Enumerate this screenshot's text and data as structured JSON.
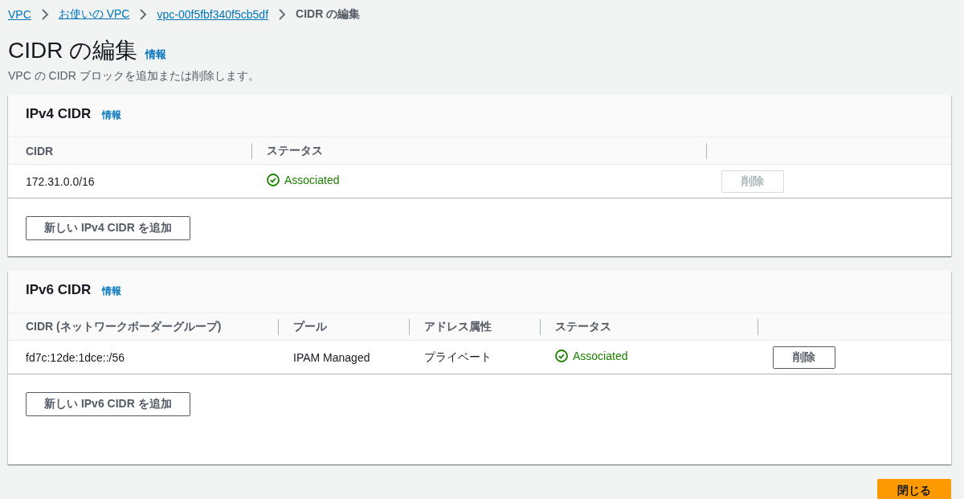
{
  "breadcrumbs": [
    {
      "label": "VPC",
      "kind": "link"
    },
    {
      "label": "お使いの VPC",
      "kind": "link"
    },
    {
      "label": "vpc-00f5fbf340f5cb5df",
      "kind": "link"
    },
    {
      "label": "CIDR の編集",
      "kind": "current"
    }
  ],
  "page": {
    "title": "CIDR の編集",
    "info": "情報",
    "description": "VPC の CIDR ブロックを追加または削除します。"
  },
  "sections": [
    {
      "title": "IPv4 CIDR",
      "info": "情報",
      "columns": [
        "CIDR",
        "ステータス",
        ""
      ],
      "rows": [
        {
          "cells": [
            {
              "kind": "text",
              "text": "172.31.0.0/16"
            },
            {
              "kind": "status",
              "text": "Associated"
            },
            {
              "kind": "button",
              "text": "削除",
              "disabled": true
            }
          ]
        }
      ],
      "add_button": "新しい IPv4 CIDR を追加"
    },
    {
      "title": "IPv6 CIDR",
      "info": "情報",
      "columns": [
        "CIDR (ネットワークボーダーグループ)",
        "プール",
        "アドレス属性",
        "ステータス",
        ""
      ],
      "rows": [
        {
          "cells": [
            {
              "kind": "text",
              "text": "fd7c:12de:1dce::/56"
            },
            {
              "kind": "text",
              "text": "IPAM Managed"
            },
            {
              "kind": "text",
              "text": "プライベート"
            },
            {
              "kind": "status",
              "text": "Associated"
            },
            {
              "kind": "button",
              "text": "削除",
              "disabled": false
            }
          ]
        }
      ],
      "add_button": "新しい IPv6 CIDR を追加"
    }
  ],
  "close_button": "閉じる"
}
